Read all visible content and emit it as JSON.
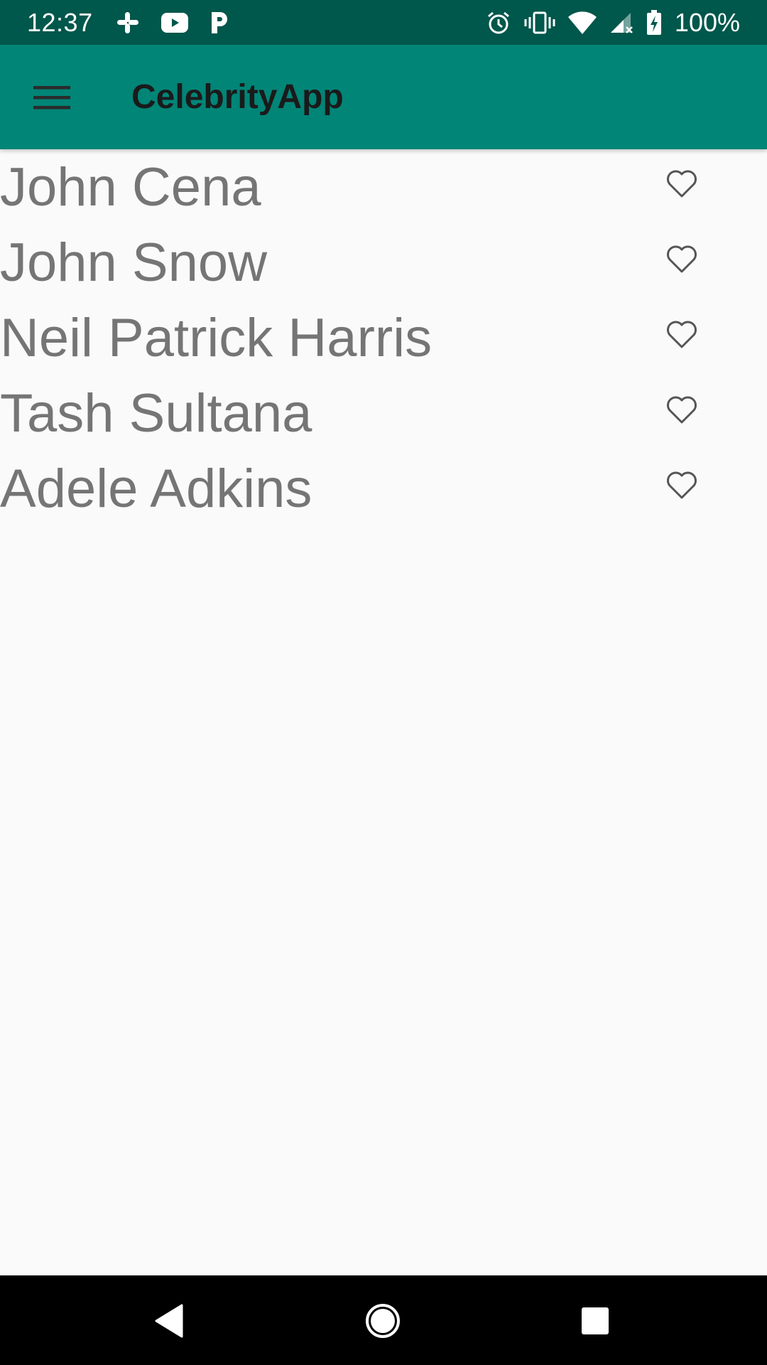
{
  "status_bar": {
    "time": "12:37",
    "battery_text": "100%",
    "left_icons": [
      "slack-icon",
      "youtube-icon",
      "pandora-icon"
    ],
    "right_icons": [
      "alarm-icon",
      "vibrate-icon",
      "wifi-icon",
      "signal-icon",
      "battery-charging-icon"
    ]
  },
  "app_bar": {
    "title": "CelebrityApp",
    "menu_icon": "hamburger-menu-icon",
    "background": "#008577"
  },
  "celebrities": [
    {
      "name": "John Cena",
      "favorite": false
    },
    {
      "name": "John Snow",
      "favorite": false
    },
    {
      "name": "Neil Patrick Harris",
      "favorite": false
    },
    {
      "name": "Tash Sultana",
      "favorite": false
    },
    {
      "name": "Adele Adkins",
      "favorite": false
    }
  ],
  "nav_bar": {
    "buttons": [
      "back-icon",
      "home-icon",
      "recents-icon"
    ]
  },
  "colors": {
    "status_bar": "#00574b",
    "app_bar": "#008577",
    "list_text": "#757575",
    "background": "#fafafa"
  }
}
